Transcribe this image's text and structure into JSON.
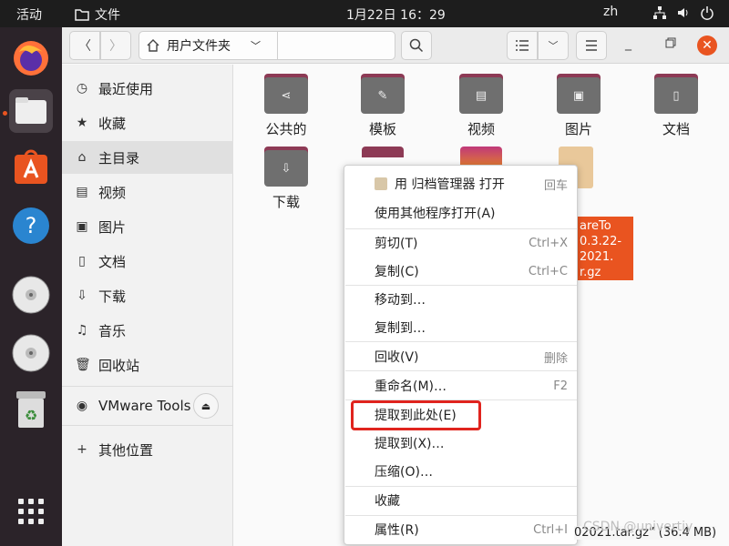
{
  "topbar": {
    "activities": "活动",
    "app_name": "文件",
    "clock": "1月22日  16：29",
    "lang": "zh"
  },
  "dock": {
    "items": [
      "firefox-icon",
      "files-icon",
      "software-icon",
      "help-icon",
      "disc-icon",
      "disc-icon",
      "trash-icon",
      "app-grid-icon"
    ]
  },
  "header": {
    "path_home": "用户文件夹"
  },
  "sidebar": {
    "items": [
      {
        "label": "最近使用",
        "icon": "clock-icon"
      },
      {
        "label": "收藏",
        "icon": "star-icon"
      },
      {
        "label": "主目录",
        "icon": "home-icon"
      },
      {
        "label": "视频",
        "icon": "video-icon"
      },
      {
        "label": "图片",
        "icon": "picture-icon"
      },
      {
        "label": "文档",
        "icon": "document-icon"
      },
      {
        "label": "下载",
        "icon": "download-icon"
      },
      {
        "label": "音乐",
        "icon": "music-icon"
      },
      {
        "label": "回收站",
        "icon": "trash-icon"
      },
      {
        "label": "VMware Tools",
        "icon": "disc-icon"
      },
      {
        "label": "其他位置",
        "icon": "plus-icon"
      }
    ]
  },
  "files": [
    {
      "label": "公共的"
    },
    {
      "label": "模板"
    },
    {
      "label": "视频"
    },
    {
      "label": "图片"
    },
    {
      "label": "文档"
    },
    {
      "label": "下载"
    },
    {
      "label": "areTo\n0.3.22-\n2021.\nr.gz"
    }
  ],
  "menu": {
    "items": [
      {
        "label": "用 归档管理器 打开",
        "accel": "回车"
      },
      {
        "label": "使用其他程序打开(A)",
        "accel": ""
      },
      {
        "label": "剪切(T)",
        "accel": "Ctrl+X"
      },
      {
        "label": "复制(C)",
        "accel": "Ctrl+C"
      },
      {
        "label": "移动到…",
        "accel": ""
      },
      {
        "label": "复制到…",
        "accel": ""
      },
      {
        "label": "回收(V)",
        "accel": "删除"
      },
      {
        "label": "重命名(M)…",
        "accel": "F2"
      },
      {
        "label": "提取到此处(E)",
        "accel": ""
      },
      {
        "label": "提取到(X)…",
        "accel": ""
      },
      {
        "label": "压缩(O)…",
        "accel": ""
      },
      {
        "label": "收藏",
        "accel": ""
      },
      {
        "label": "属性(R)",
        "accel": "Ctrl+I"
      }
    ]
  },
  "status": {
    "text": "02021.tar.gz” (36.4 MB)"
  },
  "watermark": "CSDN @univertiy",
  "colors": {
    "accent": "#e95420",
    "highlight_box": "#e0241e",
    "folder_tab": "#8d3a55"
  }
}
